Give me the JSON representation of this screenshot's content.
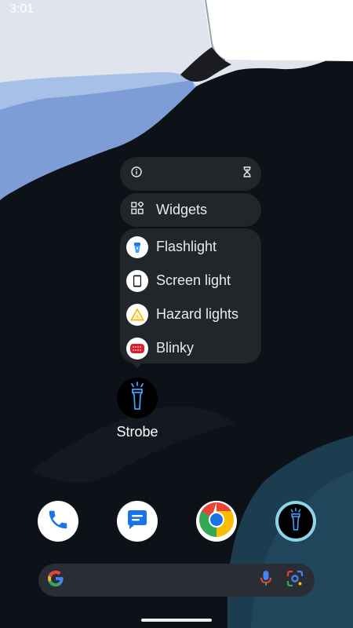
{
  "status_bar": {
    "time": "3:01"
  },
  "context_menu": {
    "info_icon": "info-icon",
    "pause_icon": "hourglass-icon",
    "widgets_label": "Widgets",
    "shortcuts": [
      {
        "label": "Flashlight",
        "icon": "flashlight-icon"
      },
      {
        "label": "Screen light",
        "icon": "phone-screen-icon"
      },
      {
        "label": "Hazard lights",
        "icon": "hazard-icon"
      },
      {
        "label": "Blinky",
        "icon": "led-icon"
      }
    ]
  },
  "app": {
    "label": "Strobe",
    "icon": "strobe-flashlight-icon"
  },
  "dock": {
    "apps": [
      {
        "name": "Phone",
        "icon": "phone-icon"
      },
      {
        "name": "Messages",
        "icon": "messages-icon"
      },
      {
        "name": "Chrome",
        "icon": "chrome-icon"
      },
      {
        "name": "Strobe",
        "icon": "strobe-flashlight-icon"
      }
    ]
  },
  "search": {
    "icons": [
      "google-g-icon",
      "mic-icon",
      "lens-icon"
    ]
  },
  "colors": {
    "menu_bg": "#22262b",
    "accent_blue": "#1a73e8",
    "flash_blue": "#3fa0ff"
  }
}
